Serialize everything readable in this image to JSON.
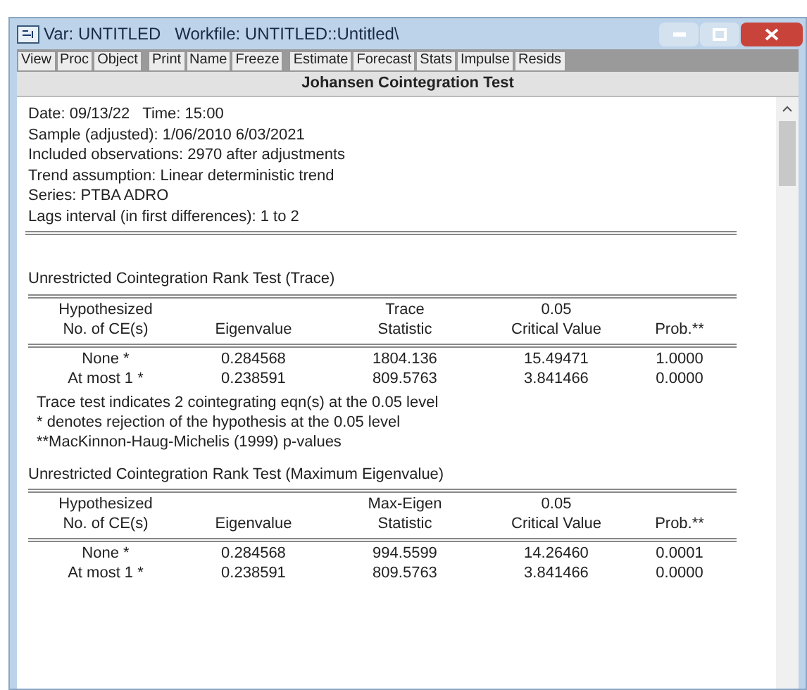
{
  "window": {
    "title": "Var: UNTITLED   Workfile: UNTITLED::Untitled\\"
  },
  "toolbar_groups": [
    [
      "View",
      "Proc",
      "Object"
    ],
    [
      "Print",
      "Name",
      "Freeze"
    ],
    [
      "Estimate",
      "Forecast",
      "Stats",
      "Impulse",
      "Resids"
    ]
  ],
  "header": "Johansen Cointegration Test",
  "info": [
    "Date: 09/13/22   Time: 15:00",
    "Sample (adjusted): 1/06/2010 6/03/2021",
    "Included observations: 2970 after adjustments",
    "Trend assumption: Linear deterministic trend",
    "Series: PTBA ADRO",
    "Lags interval (in first differences): 1 to 2"
  ],
  "tests": [
    {
      "title": "Unrestricted Cointegration Rank Test (Trace)",
      "columns": [
        "Hypothesized\nNo. of CE(s)",
        "Eigenvalue",
        "Trace\nStatistic",
        "0.05\nCritical Value",
        "Prob.**"
      ],
      "rows": [
        [
          "None *",
          "0.284568",
          "1804.136",
          "15.49471",
          "1.0000"
        ],
        [
          "At most 1 *",
          "0.238591",
          "809.5763",
          "3.841466",
          "0.0000"
        ]
      ],
      "notes": [
        "Trace test indicates 2 cointegrating eqn(s) at the 0.05 level",
        "* denotes rejection of the hypothesis at the 0.05 level",
        "**MacKinnon-Haug-Michelis (1999) p-values"
      ]
    },
    {
      "title": "Unrestricted Cointegration Rank Test (Maximum Eigenvalue)",
      "columns": [
        "Hypothesized\nNo. of CE(s)",
        "Eigenvalue",
        "Max-Eigen\nStatistic",
        "0.05\nCritical Value",
        "Prob.**"
      ],
      "rows": [
        [
          "None *",
          "0.284568",
          "994.5599",
          "14.26460",
          "0.0001"
        ],
        [
          "At most 1 *",
          "0.238591",
          "809.5763",
          "3.841466",
          "0.0000"
        ]
      ]
    }
  ]
}
